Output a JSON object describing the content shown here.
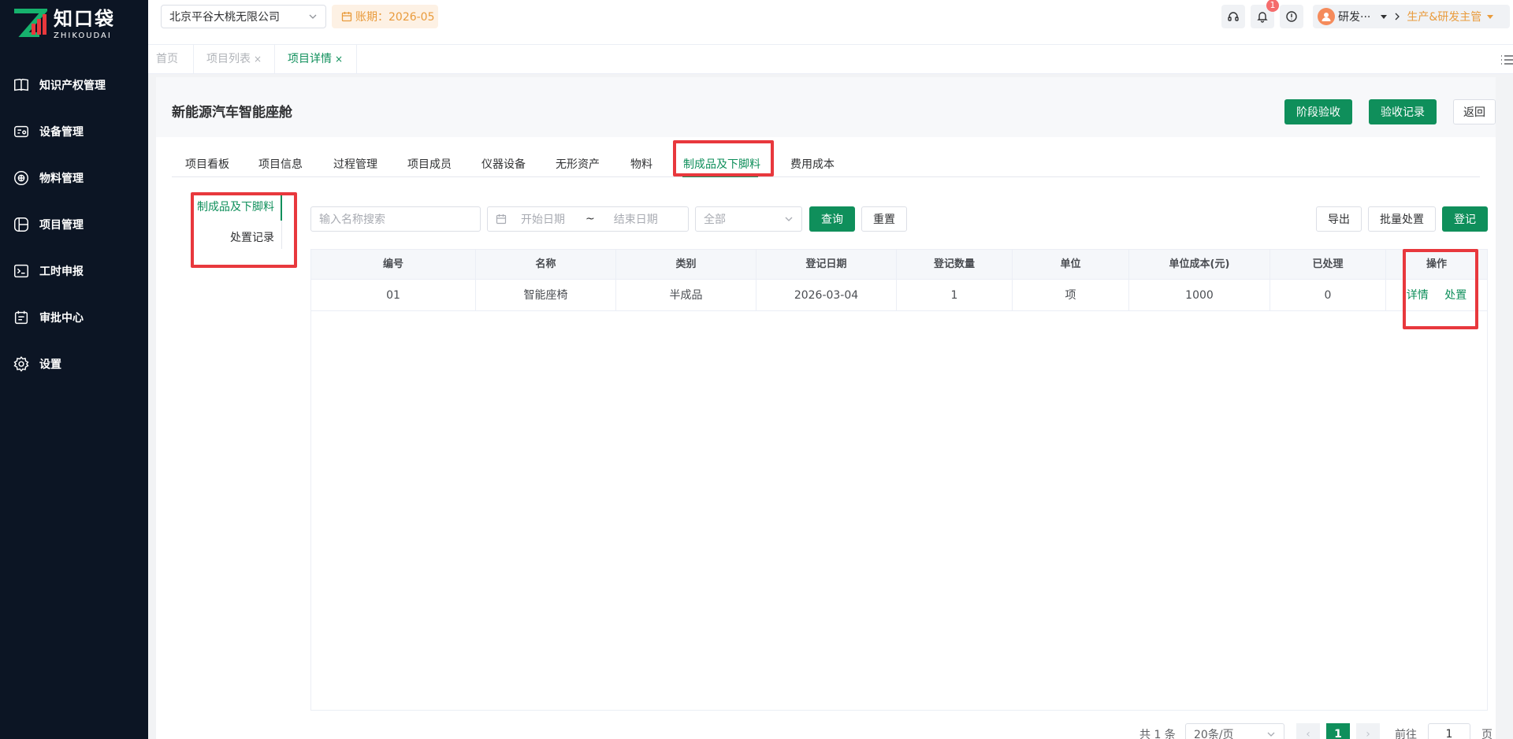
{
  "brand": {
    "name_cn": "知口袋",
    "name_en": "ZHIKOUDAI",
    "accent": "#0f8f5b",
    "logo_red": "#e8383d"
  },
  "sidebar": {
    "items": [
      {
        "label": "知识产权管理",
        "icon": "book-icon"
      },
      {
        "label": "设备管理",
        "icon": "device-icon"
      },
      {
        "label": "物料管理",
        "icon": "material-icon"
      },
      {
        "label": "项目管理",
        "icon": "project-icon"
      },
      {
        "label": "工时申报",
        "icon": "clock-icon"
      },
      {
        "label": "审批中心",
        "icon": "approval-icon"
      },
      {
        "label": "设置",
        "icon": "gear-icon"
      }
    ]
  },
  "header": {
    "company": "北京平谷大桃无限公司",
    "period": "账期：2026-05",
    "notification_count": "1",
    "user": "研发···",
    "role": "生产&研发主管"
  },
  "tabs": [
    {
      "label": "首页"
    },
    {
      "label": "项目列表",
      "close": "×"
    },
    {
      "label": "项目详情",
      "close": "×"
    }
  ],
  "page": {
    "title": "新能源汽车智能座舱",
    "actions": {
      "stage_accept": "阶段验收",
      "accept_record": "验收记录",
      "back": "返回"
    }
  },
  "sub_tabs": [
    "项目看板",
    "项目信息",
    "过程管理",
    "项目成员",
    "仪器设备",
    "无形资产",
    "物料",
    "制成品及下脚料",
    "费用成本"
  ],
  "left_menu": [
    "制成品及下脚料",
    "处置记录"
  ],
  "filters": {
    "search_placeholder": "输入名称搜索",
    "start_date": "开始日期",
    "date_sep": "~",
    "end_date": "结束日期",
    "category": "全部",
    "query": "查询",
    "reset": "重置",
    "export": "导出",
    "batch": "批量处置",
    "register": "登记"
  },
  "table": {
    "columns": [
      "编号",
      "名称",
      "类别",
      "登记日期",
      "登记数量",
      "单位",
      "单位成本(元)",
      "已处理",
      "操作"
    ],
    "rows": [
      {
        "no": "01",
        "name": "智能座椅",
        "category": "半成品",
        "date": "2026-03-04",
        "qty": "1",
        "unit": "项",
        "cost": "1000",
        "processed": "0",
        "detail": "详情",
        "dispose": "处置"
      }
    ]
  },
  "pagination": {
    "total": "共 1 条",
    "page_size": "20条/页",
    "prev": "‹",
    "current": "1",
    "next": "›",
    "goto": "前往",
    "goto_value": "1",
    "page_unit": "页"
  }
}
